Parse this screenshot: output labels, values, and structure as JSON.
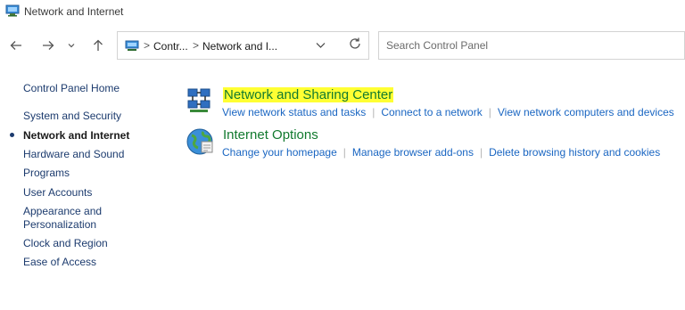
{
  "window": {
    "title": "Network and Internet"
  },
  "nav": {
    "back_icon": "arrow-left-icon",
    "forward_icon": "arrow-right-icon",
    "recent_icon": "chevron-down-icon",
    "up_icon": "arrow-up-icon",
    "refresh_icon": "refresh-icon"
  },
  "address": {
    "crumbs": [
      "Contr...",
      "Network and I..."
    ],
    "separator": ">"
  },
  "search": {
    "placeholder": "Search Control Panel"
  },
  "sidebar": {
    "items": [
      {
        "label": "Control Panel Home",
        "active": false
      },
      {
        "label": "System and Security",
        "active": false
      },
      {
        "label": "Network and Internet",
        "active": true
      },
      {
        "label": "Hardware and Sound",
        "active": false
      },
      {
        "label": "Programs",
        "active": false
      },
      {
        "label": "User Accounts",
        "active": false
      },
      {
        "label": "Appearance and Personalization",
        "active": false
      },
      {
        "label": "Clock and Region",
        "active": false
      },
      {
        "label": "Ease of Access",
        "active": false
      }
    ]
  },
  "categories": [
    {
      "title": "Network and Sharing Center",
      "icon": "network-sharing-icon",
      "highlighted": true,
      "links": [
        "View network status and tasks",
        "Connect to a network",
        "View network computers and devices"
      ]
    },
    {
      "title": "Internet Options",
      "icon": "internet-options-globe-icon",
      "highlighted": false,
      "links": [
        "Change your homepage",
        "Manage browser add-ons",
        "Delete browsing history and cookies"
      ]
    }
  ],
  "colors": {
    "category_title": "#127a2f",
    "link": "#1a66c2",
    "sidebar_link": "#1c3b6e",
    "highlight": "#ffff33"
  }
}
